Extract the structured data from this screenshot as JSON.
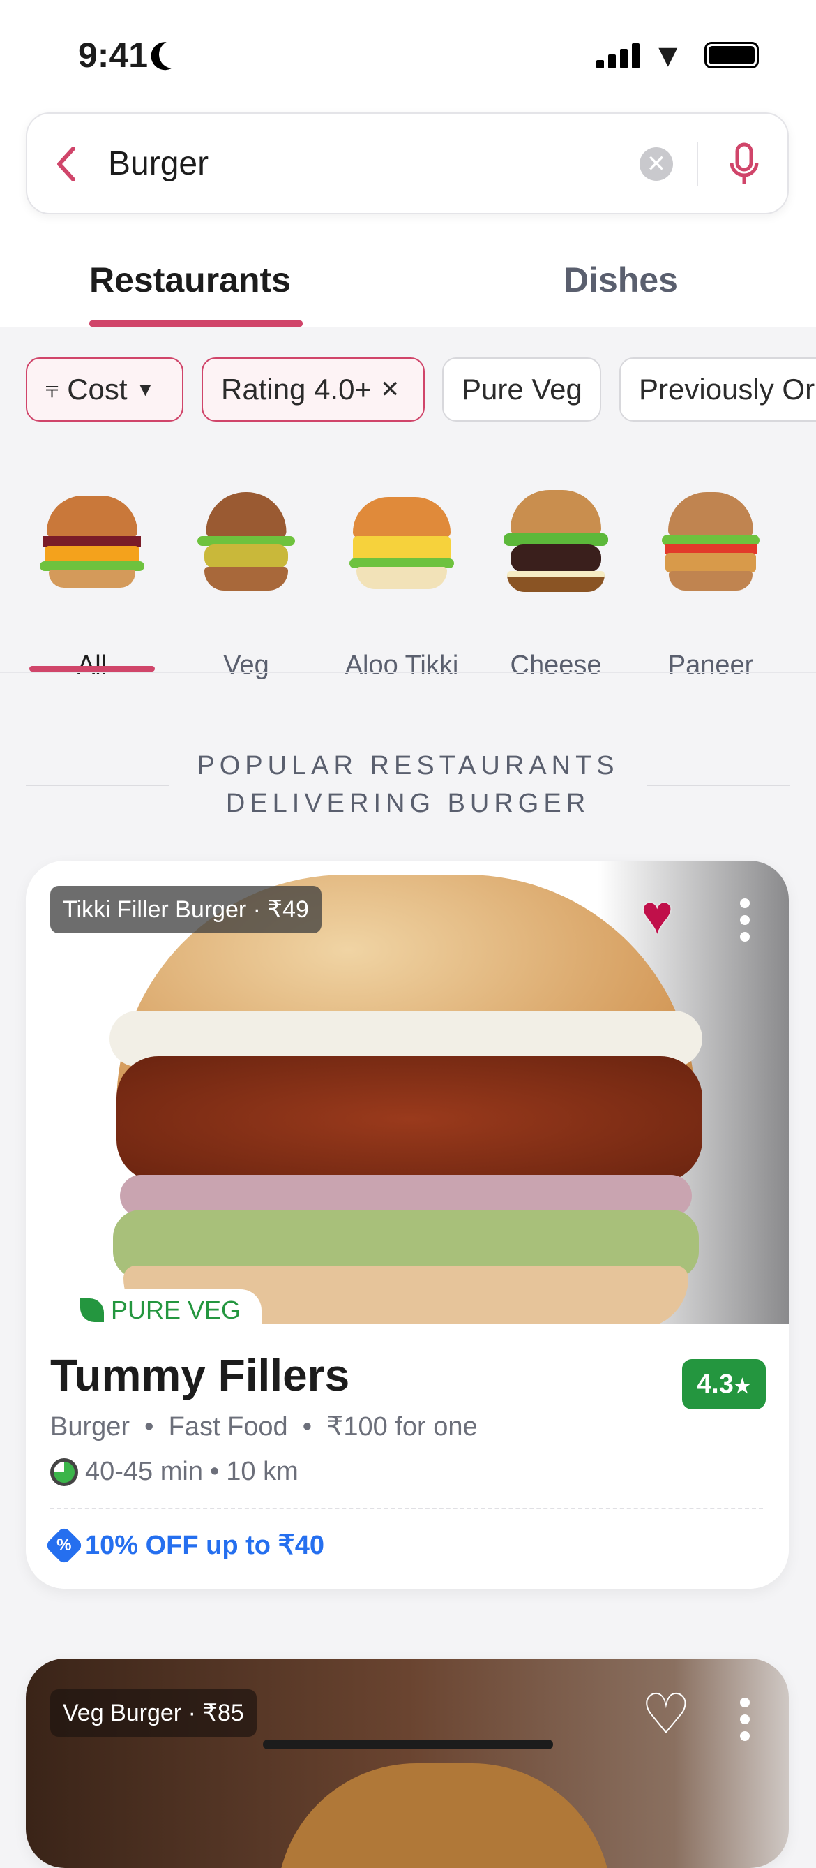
{
  "status": {
    "time": "9:41"
  },
  "search": {
    "query": "Burger"
  },
  "tabs": [
    {
      "label": "Restaurants",
      "active": true
    },
    {
      "label": "Dishes",
      "active": false
    }
  ],
  "filters": [
    {
      "label": "Cost",
      "active": true
    },
    {
      "label": "Rating 4.0+",
      "active": true
    },
    {
      "label": "Pure Veg",
      "active": false
    },
    {
      "label": "Previously Or",
      "active": false
    }
  ],
  "categories": [
    {
      "label": "All",
      "active": true
    },
    {
      "label": "Veg"
    },
    {
      "label": "Aloo Tikki"
    },
    {
      "label": "Cheese"
    },
    {
      "label": "Paneer"
    }
  ],
  "section": {
    "line1": "POPULAR RESTAURANTS",
    "line2": "DELIVERING BURGER"
  },
  "restaurants": [
    {
      "dish_tag": "Tikki Filler Burger · ₹49",
      "favorited": true,
      "badge": "PURE VEG",
      "name": "Tummy Fillers",
      "rating": "4.3",
      "cuisine": "Burger",
      "cuisine2": "Fast Food",
      "price": "₹100 for one",
      "eta": "40-45 min",
      "distance": "10 km",
      "offer": "10% OFF up to ₹40"
    },
    {
      "dish_tag": "Veg Burger · ₹85",
      "favorited": false
    }
  ],
  "colors": {
    "accent": "#d0456a",
    "rating": "#24963f",
    "offer": "#256fef",
    "veg": "#24963f"
  }
}
